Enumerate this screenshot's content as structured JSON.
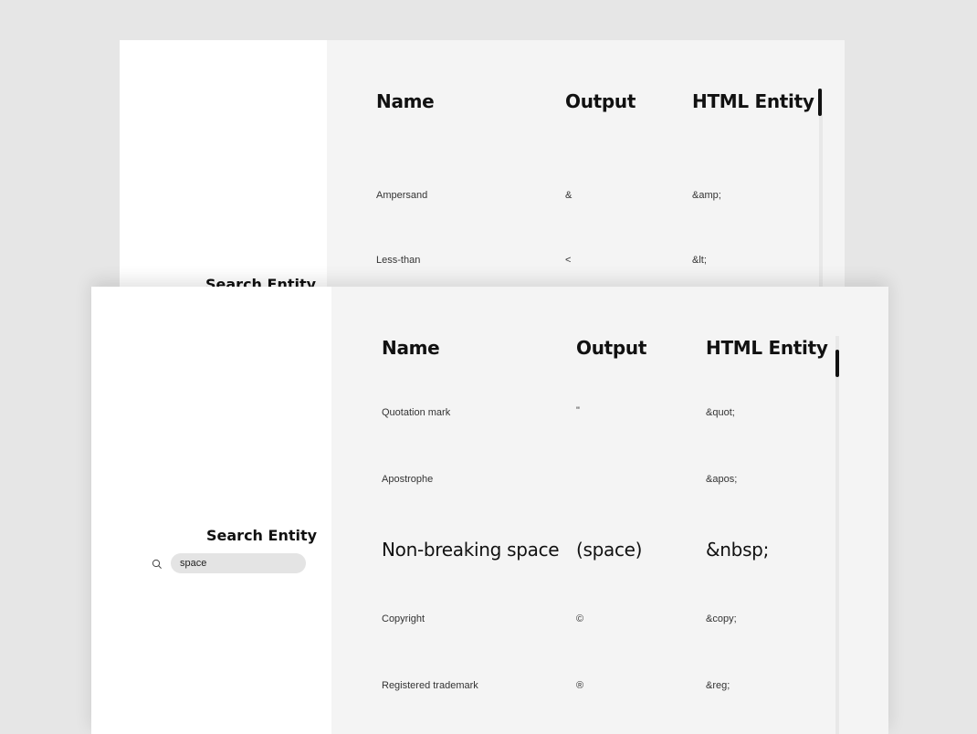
{
  "headers": {
    "name": "Name",
    "output": "Output",
    "entity": "HTML Entity"
  },
  "search": {
    "title": "Search Entity",
    "value": "space",
    "icon": "search-icon"
  },
  "back_rows": [
    {
      "name": "Ampersand",
      "output": "&",
      "entity": "&amp;"
    },
    {
      "name": "Less-than",
      "output": "<",
      "entity": "&lt;"
    }
  ],
  "front_rows": [
    {
      "name": "Quotation mark",
      "output": "\"",
      "entity": "&quot;"
    },
    {
      "name": "Apostrophe",
      "output": "",
      "entity": "&apos;"
    },
    {
      "name": "Non-breaking space",
      "output": "(space)",
      "entity": "&nbsp;"
    },
    {
      "name": "Copyright",
      "output": "©",
      "entity": "&copy;"
    },
    {
      "name": "Registered trademark",
      "output": "®",
      "entity": "&reg;"
    }
  ],
  "colors": {
    "page_bg": "#e6e6e6",
    "panel_bg": "#f4f4f4",
    "text": "#111111",
    "input_bg": "#e4e4e4"
  }
}
